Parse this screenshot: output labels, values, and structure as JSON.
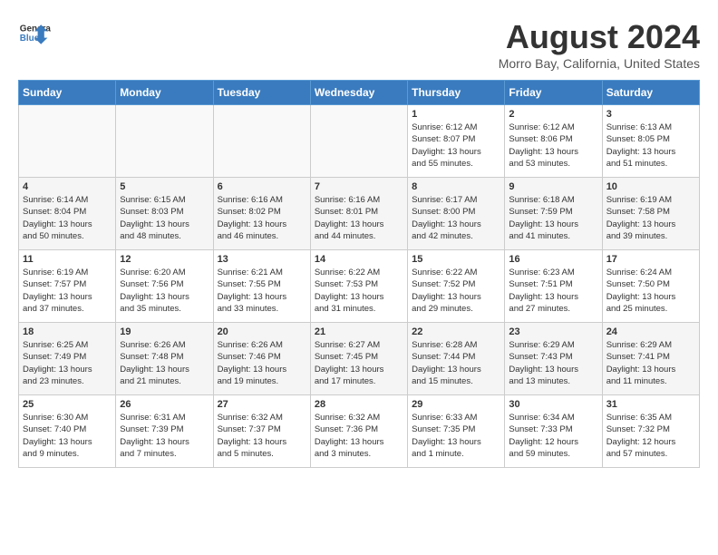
{
  "header": {
    "logo_line1": "General",
    "logo_line2": "Blue",
    "title": "August 2024",
    "subtitle": "Morro Bay, California, United States"
  },
  "days_of_week": [
    "Sunday",
    "Monday",
    "Tuesday",
    "Wednesday",
    "Thursday",
    "Friday",
    "Saturday"
  ],
  "weeks": [
    [
      {
        "day": "",
        "info": ""
      },
      {
        "day": "",
        "info": ""
      },
      {
        "day": "",
        "info": ""
      },
      {
        "day": "",
        "info": ""
      },
      {
        "day": "1",
        "info": "Sunrise: 6:12 AM\nSunset: 8:07 PM\nDaylight: 13 hours\nand 55 minutes."
      },
      {
        "day": "2",
        "info": "Sunrise: 6:12 AM\nSunset: 8:06 PM\nDaylight: 13 hours\nand 53 minutes."
      },
      {
        "day": "3",
        "info": "Sunrise: 6:13 AM\nSunset: 8:05 PM\nDaylight: 13 hours\nand 51 minutes."
      }
    ],
    [
      {
        "day": "4",
        "info": "Sunrise: 6:14 AM\nSunset: 8:04 PM\nDaylight: 13 hours\nand 50 minutes."
      },
      {
        "day": "5",
        "info": "Sunrise: 6:15 AM\nSunset: 8:03 PM\nDaylight: 13 hours\nand 48 minutes."
      },
      {
        "day": "6",
        "info": "Sunrise: 6:16 AM\nSunset: 8:02 PM\nDaylight: 13 hours\nand 46 minutes."
      },
      {
        "day": "7",
        "info": "Sunrise: 6:16 AM\nSunset: 8:01 PM\nDaylight: 13 hours\nand 44 minutes."
      },
      {
        "day": "8",
        "info": "Sunrise: 6:17 AM\nSunset: 8:00 PM\nDaylight: 13 hours\nand 42 minutes."
      },
      {
        "day": "9",
        "info": "Sunrise: 6:18 AM\nSunset: 7:59 PM\nDaylight: 13 hours\nand 41 minutes."
      },
      {
        "day": "10",
        "info": "Sunrise: 6:19 AM\nSunset: 7:58 PM\nDaylight: 13 hours\nand 39 minutes."
      }
    ],
    [
      {
        "day": "11",
        "info": "Sunrise: 6:19 AM\nSunset: 7:57 PM\nDaylight: 13 hours\nand 37 minutes."
      },
      {
        "day": "12",
        "info": "Sunrise: 6:20 AM\nSunset: 7:56 PM\nDaylight: 13 hours\nand 35 minutes."
      },
      {
        "day": "13",
        "info": "Sunrise: 6:21 AM\nSunset: 7:55 PM\nDaylight: 13 hours\nand 33 minutes."
      },
      {
        "day": "14",
        "info": "Sunrise: 6:22 AM\nSunset: 7:53 PM\nDaylight: 13 hours\nand 31 minutes."
      },
      {
        "day": "15",
        "info": "Sunrise: 6:22 AM\nSunset: 7:52 PM\nDaylight: 13 hours\nand 29 minutes."
      },
      {
        "day": "16",
        "info": "Sunrise: 6:23 AM\nSunset: 7:51 PM\nDaylight: 13 hours\nand 27 minutes."
      },
      {
        "day": "17",
        "info": "Sunrise: 6:24 AM\nSunset: 7:50 PM\nDaylight: 13 hours\nand 25 minutes."
      }
    ],
    [
      {
        "day": "18",
        "info": "Sunrise: 6:25 AM\nSunset: 7:49 PM\nDaylight: 13 hours\nand 23 minutes."
      },
      {
        "day": "19",
        "info": "Sunrise: 6:26 AM\nSunset: 7:48 PM\nDaylight: 13 hours\nand 21 minutes."
      },
      {
        "day": "20",
        "info": "Sunrise: 6:26 AM\nSunset: 7:46 PM\nDaylight: 13 hours\nand 19 minutes."
      },
      {
        "day": "21",
        "info": "Sunrise: 6:27 AM\nSunset: 7:45 PM\nDaylight: 13 hours\nand 17 minutes."
      },
      {
        "day": "22",
        "info": "Sunrise: 6:28 AM\nSunset: 7:44 PM\nDaylight: 13 hours\nand 15 minutes."
      },
      {
        "day": "23",
        "info": "Sunrise: 6:29 AM\nSunset: 7:43 PM\nDaylight: 13 hours\nand 13 minutes."
      },
      {
        "day": "24",
        "info": "Sunrise: 6:29 AM\nSunset: 7:41 PM\nDaylight: 13 hours\nand 11 minutes."
      }
    ],
    [
      {
        "day": "25",
        "info": "Sunrise: 6:30 AM\nSunset: 7:40 PM\nDaylight: 13 hours\nand 9 minutes."
      },
      {
        "day": "26",
        "info": "Sunrise: 6:31 AM\nSunset: 7:39 PM\nDaylight: 13 hours\nand 7 minutes."
      },
      {
        "day": "27",
        "info": "Sunrise: 6:32 AM\nSunset: 7:37 PM\nDaylight: 13 hours\nand 5 minutes."
      },
      {
        "day": "28",
        "info": "Sunrise: 6:32 AM\nSunset: 7:36 PM\nDaylight: 13 hours\nand 3 minutes."
      },
      {
        "day": "29",
        "info": "Sunrise: 6:33 AM\nSunset: 7:35 PM\nDaylight: 13 hours\nand 1 minute."
      },
      {
        "day": "30",
        "info": "Sunrise: 6:34 AM\nSunset: 7:33 PM\nDaylight: 12 hours\nand 59 minutes."
      },
      {
        "day": "31",
        "info": "Sunrise: 6:35 AM\nSunset: 7:32 PM\nDaylight: 12 hours\nand 57 minutes."
      }
    ]
  ]
}
